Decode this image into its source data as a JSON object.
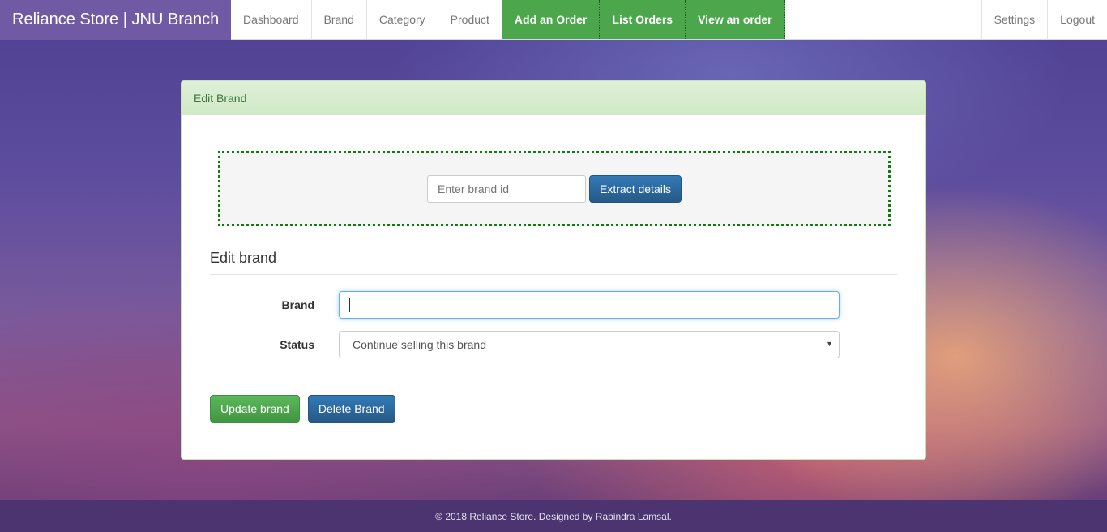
{
  "navbar": {
    "brand": "Reliance Store | JNU Branch",
    "links": [
      "Dashboard",
      "Brand",
      "Category",
      "Product"
    ],
    "order_links": [
      "Add an Order",
      "List Orders",
      "View an order"
    ],
    "right_links": [
      "Settings",
      "Logout"
    ]
  },
  "panel": {
    "heading": "Edit Brand",
    "extract": {
      "input_placeholder": "Enter brand id",
      "input_value": "",
      "button_label": "Extract details"
    },
    "form": {
      "title": "Edit brand",
      "brand_label": "Brand",
      "brand_value": "",
      "status_label": "Status",
      "status_selected": "Continue selling this brand"
    },
    "actions": {
      "update_label": "Update brand",
      "delete_label": "Delete Brand"
    }
  },
  "footer": {
    "text": "© 2018 Reliance Store. Designed by Rabindra Lamsal."
  },
  "colors": {
    "accent_green": "#4ca64c",
    "brand_purple": "#6f5aa3",
    "primary_blue": "#337ab7"
  }
}
